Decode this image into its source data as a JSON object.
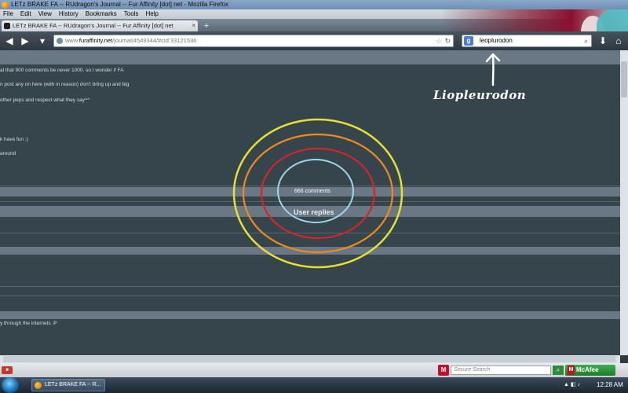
{
  "window": {
    "title": "LETz BRAKE FA -- RUdragon's Journal -- Fur Affinity [dot] net - Mozilla Firefox"
  },
  "menu": {
    "items": [
      "File",
      "Edit",
      "View",
      "History",
      "Bookmarks",
      "Tools",
      "Help"
    ]
  },
  "tab": {
    "label": "LETz BRAKE FA -- RUdragon's Journal -- Fur Affinity [dot] net",
    "new_tab_symbol": "+"
  },
  "address": {
    "prefix": "www.",
    "domain": "furaffinity.net",
    "path": "/journal/4549344/#cid:33121536"
  },
  "search": {
    "engine_letter": "g",
    "value": "leoplurodon"
  },
  "page": {
    "lines": [
      "al that 900 comments be never 1000. so I wonder if FA",
      "n post any on here (with in reason) don't bring up and big",
      "other peps and respect what they say^^",
      "k have fun :)",
      "around",
      "y through the internets :P"
    ]
  },
  "annotation": {
    "handwritten_label": "Liopleurodon",
    "ring_small_text": "666 comments",
    "ring_big_text": "User replies",
    "ring_colors": [
      "#e8e030",
      "#f08a1a",
      "#d8232a",
      "#9fd6e8"
    ]
  },
  "statusbar": {
    "secure_search_placeholder": "Secure Search",
    "mcafee_label": "McAfee"
  },
  "taskbar": {
    "task_label": "LETz BRAKE FA -- R...",
    "clock": "12:28 AM"
  }
}
